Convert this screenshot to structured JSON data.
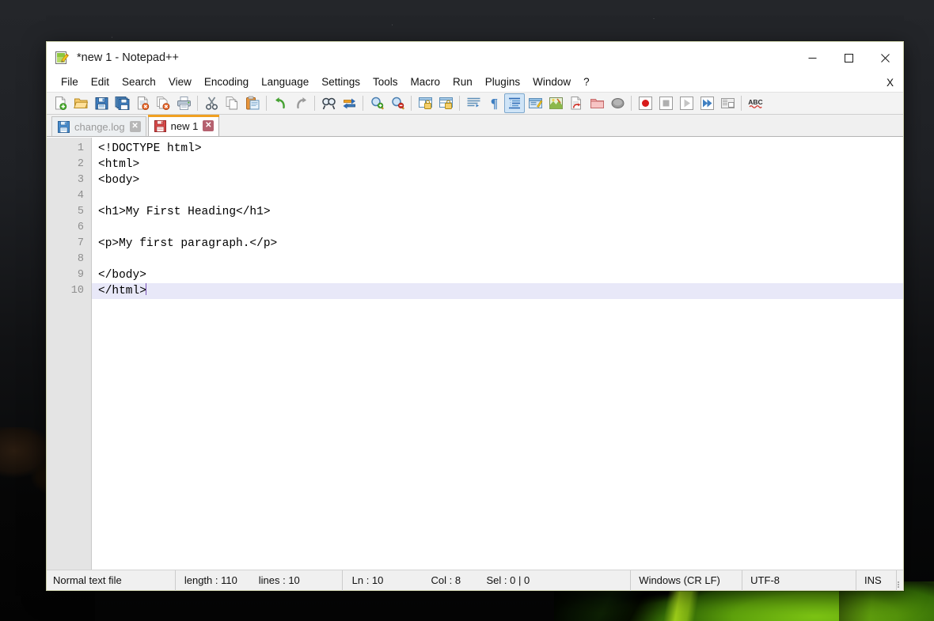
{
  "window": {
    "title": "*new 1 - Notepad++",
    "app_icon": "notepad-plus-plus-icon",
    "controls": {
      "minimize": "minimize-icon",
      "maximize": "maximize-icon",
      "close": "close-icon"
    }
  },
  "menubar": {
    "items": [
      {
        "label": "File"
      },
      {
        "label": "Edit"
      },
      {
        "label": "Search"
      },
      {
        "label": "View"
      },
      {
        "label": "Encoding"
      },
      {
        "label": "Language"
      },
      {
        "label": "Settings"
      },
      {
        "label": "Tools"
      },
      {
        "label": "Macro"
      },
      {
        "label": "Run"
      },
      {
        "label": "Plugins"
      },
      {
        "label": "Window"
      },
      {
        "label": "?"
      }
    ],
    "close_document": "X"
  },
  "toolbar": {
    "buttons": [
      {
        "name": "new-file-icon",
        "title": "New"
      },
      {
        "name": "open-file-icon",
        "title": "Open"
      },
      {
        "name": "save-icon",
        "title": "Save"
      },
      {
        "name": "save-all-icon",
        "title": "Save All"
      },
      {
        "name": "close-file-icon",
        "title": "Close"
      },
      {
        "name": "close-all-files-icon",
        "title": "Close All"
      },
      {
        "name": "print-icon",
        "title": "Print"
      },
      {
        "name": "separator-1",
        "title": ""
      },
      {
        "name": "cut-icon",
        "title": "Cut"
      },
      {
        "name": "copy-icon",
        "title": "Copy"
      },
      {
        "name": "paste-icon",
        "title": "Paste"
      },
      {
        "name": "separator-2",
        "title": ""
      },
      {
        "name": "undo-icon",
        "title": "Undo"
      },
      {
        "name": "redo-icon",
        "title": "Redo"
      },
      {
        "name": "separator-3",
        "title": ""
      },
      {
        "name": "find-icon",
        "title": "Find"
      },
      {
        "name": "replace-icon",
        "title": "Replace"
      },
      {
        "name": "separator-4",
        "title": ""
      },
      {
        "name": "zoom-in-icon",
        "title": "Zoom In"
      },
      {
        "name": "zoom-out-icon",
        "title": "Zoom Out"
      },
      {
        "name": "separator-5",
        "title": ""
      },
      {
        "name": "sync-vertical-scrolling-icon",
        "title": "Synchronize Vertical Scrolling"
      },
      {
        "name": "sync-horizontal-scrolling-icon",
        "title": "Synchronize Horizontal Scrolling"
      },
      {
        "name": "word-wrap-icon",
        "title": "Word wrap"
      },
      {
        "name": "show-all-characters-icon",
        "title": "Show All Characters"
      },
      {
        "name": "show-indent-guide-icon",
        "title": "Show Indent Guide"
      },
      {
        "name": "user-defined-dialogue-icon",
        "title": "UserDefine Dialogue"
      },
      {
        "name": "document-map-icon",
        "title": "Document Map"
      },
      {
        "name": "function-list-icon",
        "title": "Function List"
      },
      {
        "name": "folder-as-workspace-icon",
        "title": "Folder as Workspace"
      },
      {
        "name": "monitoring-icon",
        "title": "Monitoring"
      },
      {
        "name": "separator-6",
        "title": ""
      },
      {
        "name": "record-macro-icon",
        "title": "Start Recording"
      },
      {
        "name": "stop-recording-icon",
        "title": "Stop Recording"
      },
      {
        "name": "playback-icon",
        "title": "Playback"
      },
      {
        "name": "run-macro-multiple-icon",
        "title": "Run a Macro Multiple Times"
      },
      {
        "name": "save-macro-icon",
        "title": "Save Currently Recorded Macro"
      },
      {
        "name": "separator-7",
        "title": ""
      },
      {
        "name": "spell-check-icon",
        "title": "Spell Check"
      }
    ]
  },
  "tabs": [
    {
      "label": "change.log",
      "icon": "blue-save-icon",
      "active": false,
      "close": "✕"
    },
    {
      "label": "new 1",
      "icon": "red-save-icon",
      "active": true,
      "close": "✕"
    }
  ],
  "editor": {
    "lines": [
      {
        "number": "1",
        "text": "<!DOCTYPE html>"
      },
      {
        "number": "2",
        "text": "<html>"
      },
      {
        "number": "3",
        "text": "<body>"
      },
      {
        "number": "4",
        "text": ""
      },
      {
        "number": "5",
        "text": "<h1>My First Heading</h1>"
      },
      {
        "number": "6",
        "text": ""
      },
      {
        "number": "7",
        "text": "<p>My first paragraph.</p>"
      },
      {
        "number": "8",
        "text": ""
      },
      {
        "number": "9",
        "text": "</body>"
      },
      {
        "number": "10",
        "text": "</html>"
      }
    ],
    "current_line": 10,
    "caret_after_text": "</html>"
  },
  "statusbar": {
    "doc_type": "Normal text file",
    "length": "length : 110",
    "lines": "lines : 10",
    "ln": "Ln : 10",
    "col": "Col : 8",
    "sel": "Sel : 0 | 0",
    "eol": "Windows (CR LF)",
    "encoding": "UTF-8",
    "insert_mode": "INS",
    "resize_grip": "resize-grip-icon"
  },
  "colors": {
    "active_tab_accent": "#f0a021",
    "current_line_highlight": "#e8e8f8",
    "caret": "#7a53b5",
    "gutter_background": "#e4e4e4",
    "toolbar_background": "#f3f3f3",
    "statusbar_background": "#f0f0f0",
    "window_border": "#c7cba6"
  }
}
